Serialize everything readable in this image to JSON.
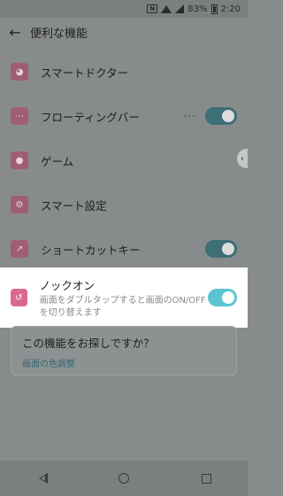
{
  "status_bar": {
    "notification_icon": "N",
    "battery_percent": "83%",
    "time": "2:20"
  },
  "app_bar": {
    "title": "便利な機能"
  },
  "items": [
    {
      "label": "スマートドクター",
      "icon": "doctor-icon",
      "has_toggle": false
    },
    {
      "label": "フローティングバー",
      "icon": "floating-bar-icon",
      "has_toggle": true,
      "toggle_on": true,
      "has_overflow": true
    },
    {
      "label": "ゲーム",
      "icon": "game-icon",
      "has_toggle": false
    },
    {
      "label": "スマート設定",
      "icon": "smart-settings-icon",
      "has_toggle": false
    },
    {
      "label": "ショートカットキー",
      "icon": "shortcut-icon",
      "has_toggle": true,
      "toggle_on": true
    }
  ],
  "knock_on": {
    "title": "ノックオン",
    "description": "画面をダブルタップすると画面のON/OFFを切り替えます",
    "toggle_on": true,
    "icon": "knock-on-icon"
  },
  "help_card": {
    "question": "この機能をお探しですか？",
    "link": "画面の色調整"
  },
  "colors": {
    "accent": "#5bc4d3",
    "icon_pink": "#d96a8d",
    "dimmed_icon": "#a05e72"
  }
}
